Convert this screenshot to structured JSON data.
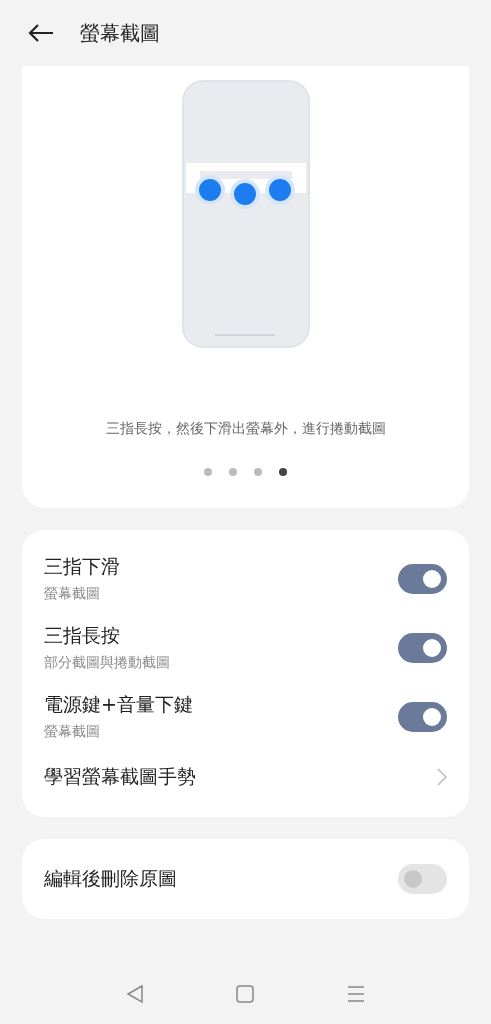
{
  "header": {
    "title": "螢幕截圖"
  },
  "tutorial": {
    "caption": "三指長按，然後下滑出螢幕外，進行捲動截圖",
    "pages": [
      {
        "selected": false
      },
      {
        "selected": false
      },
      {
        "selected": false
      },
      {
        "selected": true
      }
    ]
  },
  "settings": [
    {
      "kind": "toggle",
      "title": "三指下滑",
      "subtitle": "螢幕截圖",
      "on": true
    },
    {
      "kind": "toggle",
      "title": "三指長按",
      "subtitle": "部分截圖與捲動截圖",
      "on": true
    },
    {
      "kind": "toggle",
      "title": "電源鍵+音量下鍵",
      "subtitle": "螢幕截圖",
      "on": true
    },
    {
      "kind": "link",
      "title": "學習螢幕截圖手勢"
    }
  ],
  "more_settings": [
    {
      "kind": "toggle",
      "title": "編輯後刪除原圖",
      "on": false
    }
  ]
}
